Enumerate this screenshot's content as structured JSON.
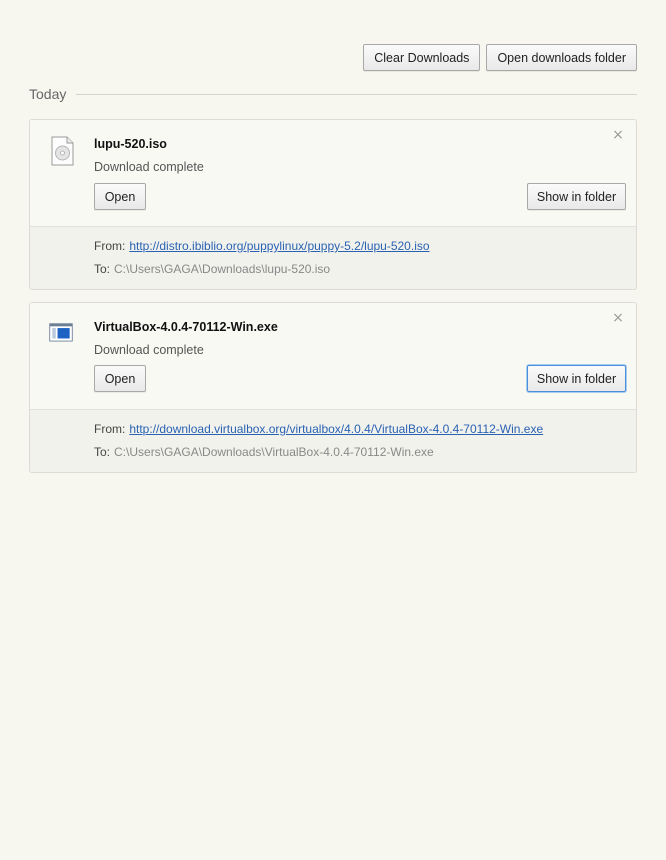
{
  "toolbar": {
    "clear_label": "Clear Downloads",
    "open_folder_label": "Open downloads folder"
  },
  "section": {
    "title": "Today"
  },
  "downloads": [
    {
      "file_name": "lupu-520.iso",
      "status": "Download complete",
      "open_label": "Open",
      "show_label": "Show in folder",
      "close_glyph": "×",
      "from_label": "From:",
      "from_url": "http://distro.ibiblio.org/puppylinux/puppy-5.2/lupu-520.iso",
      "to_label": "To:",
      "to_path": "C:\\Users\\GAGA\\Downloads\\lupu-520.iso",
      "icon": "disc-file-icon"
    },
    {
      "file_name": "VirtualBox-4.0.4-70112-Win.exe",
      "status": "Download complete",
      "open_label": "Open",
      "show_label": "Show in folder",
      "close_glyph": "×",
      "from_label": "From:",
      "from_url": "http://download.virtualbox.org/virtualbox/4.0.4/VirtualBox-4.0.4-70112-Win.exe",
      "to_label": "To:",
      "to_path": "C:\\Users\\GAGA\\Downloads\\VirtualBox-4.0.4-70112-Win.exe",
      "icon": "application-window-icon"
    }
  ],
  "colors": {
    "background": "#f7f7f0",
    "link": "#2a62b3",
    "focus": "#4a90d9"
  }
}
